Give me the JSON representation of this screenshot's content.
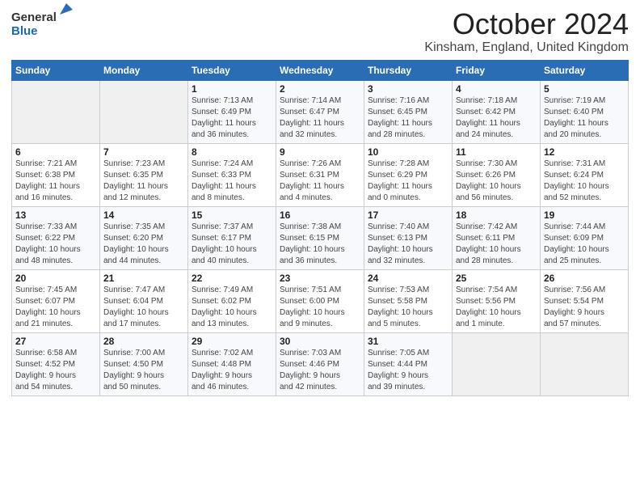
{
  "header": {
    "logo_general": "General",
    "logo_blue": "Blue",
    "month": "October 2024",
    "location": "Kinsham, England, United Kingdom"
  },
  "days_of_week": [
    "Sunday",
    "Monday",
    "Tuesday",
    "Wednesday",
    "Thursday",
    "Friday",
    "Saturday"
  ],
  "weeks": [
    [
      {
        "day": "",
        "detail": ""
      },
      {
        "day": "",
        "detail": ""
      },
      {
        "day": "1",
        "detail": "Sunrise: 7:13 AM\nSunset: 6:49 PM\nDaylight: 11 hours\nand 36 minutes."
      },
      {
        "day": "2",
        "detail": "Sunrise: 7:14 AM\nSunset: 6:47 PM\nDaylight: 11 hours\nand 32 minutes."
      },
      {
        "day": "3",
        "detail": "Sunrise: 7:16 AM\nSunset: 6:45 PM\nDaylight: 11 hours\nand 28 minutes."
      },
      {
        "day": "4",
        "detail": "Sunrise: 7:18 AM\nSunset: 6:42 PM\nDaylight: 11 hours\nand 24 minutes."
      },
      {
        "day": "5",
        "detail": "Sunrise: 7:19 AM\nSunset: 6:40 PM\nDaylight: 11 hours\nand 20 minutes."
      }
    ],
    [
      {
        "day": "6",
        "detail": "Sunrise: 7:21 AM\nSunset: 6:38 PM\nDaylight: 11 hours\nand 16 minutes."
      },
      {
        "day": "7",
        "detail": "Sunrise: 7:23 AM\nSunset: 6:35 PM\nDaylight: 11 hours\nand 12 minutes."
      },
      {
        "day": "8",
        "detail": "Sunrise: 7:24 AM\nSunset: 6:33 PM\nDaylight: 11 hours\nand 8 minutes."
      },
      {
        "day": "9",
        "detail": "Sunrise: 7:26 AM\nSunset: 6:31 PM\nDaylight: 11 hours\nand 4 minutes."
      },
      {
        "day": "10",
        "detail": "Sunrise: 7:28 AM\nSunset: 6:29 PM\nDaylight: 11 hours\nand 0 minutes."
      },
      {
        "day": "11",
        "detail": "Sunrise: 7:30 AM\nSunset: 6:26 PM\nDaylight: 10 hours\nand 56 minutes."
      },
      {
        "day": "12",
        "detail": "Sunrise: 7:31 AM\nSunset: 6:24 PM\nDaylight: 10 hours\nand 52 minutes."
      }
    ],
    [
      {
        "day": "13",
        "detail": "Sunrise: 7:33 AM\nSunset: 6:22 PM\nDaylight: 10 hours\nand 48 minutes."
      },
      {
        "day": "14",
        "detail": "Sunrise: 7:35 AM\nSunset: 6:20 PM\nDaylight: 10 hours\nand 44 minutes."
      },
      {
        "day": "15",
        "detail": "Sunrise: 7:37 AM\nSunset: 6:17 PM\nDaylight: 10 hours\nand 40 minutes."
      },
      {
        "day": "16",
        "detail": "Sunrise: 7:38 AM\nSunset: 6:15 PM\nDaylight: 10 hours\nand 36 minutes."
      },
      {
        "day": "17",
        "detail": "Sunrise: 7:40 AM\nSunset: 6:13 PM\nDaylight: 10 hours\nand 32 minutes."
      },
      {
        "day": "18",
        "detail": "Sunrise: 7:42 AM\nSunset: 6:11 PM\nDaylight: 10 hours\nand 28 minutes."
      },
      {
        "day": "19",
        "detail": "Sunrise: 7:44 AM\nSunset: 6:09 PM\nDaylight: 10 hours\nand 25 minutes."
      }
    ],
    [
      {
        "day": "20",
        "detail": "Sunrise: 7:45 AM\nSunset: 6:07 PM\nDaylight: 10 hours\nand 21 minutes."
      },
      {
        "day": "21",
        "detail": "Sunrise: 7:47 AM\nSunset: 6:04 PM\nDaylight: 10 hours\nand 17 minutes."
      },
      {
        "day": "22",
        "detail": "Sunrise: 7:49 AM\nSunset: 6:02 PM\nDaylight: 10 hours\nand 13 minutes."
      },
      {
        "day": "23",
        "detail": "Sunrise: 7:51 AM\nSunset: 6:00 PM\nDaylight: 10 hours\nand 9 minutes."
      },
      {
        "day": "24",
        "detail": "Sunrise: 7:53 AM\nSunset: 5:58 PM\nDaylight: 10 hours\nand 5 minutes."
      },
      {
        "day": "25",
        "detail": "Sunrise: 7:54 AM\nSunset: 5:56 PM\nDaylight: 10 hours\nand 1 minute."
      },
      {
        "day": "26",
        "detail": "Sunrise: 7:56 AM\nSunset: 5:54 PM\nDaylight: 9 hours\nand 57 minutes."
      }
    ],
    [
      {
        "day": "27",
        "detail": "Sunrise: 6:58 AM\nSunset: 4:52 PM\nDaylight: 9 hours\nand 54 minutes."
      },
      {
        "day": "28",
        "detail": "Sunrise: 7:00 AM\nSunset: 4:50 PM\nDaylight: 9 hours\nand 50 minutes."
      },
      {
        "day": "29",
        "detail": "Sunrise: 7:02 AM\nSunset: 4:48 PM\nDaylight: 9 hours\nand 46 minutes."
      },
      {
        "day": "30",
        "detail": "Sunrise: 7:03 AM\nSunset: 4:46 PM\nDaylight: 9 hours\nand 42 minutes."
      },
      {
        "day": "31",
        "detail": "Sunrise: 7:05 AM\nSunset: 4:44 PM\nDaylight: 9 hours\nand 39 minutes."
      },
      {
        "day": "",
        "detail": ""
      },
      {
        "day": "",
        "detail": ""
      }
    ]
  ]
}
